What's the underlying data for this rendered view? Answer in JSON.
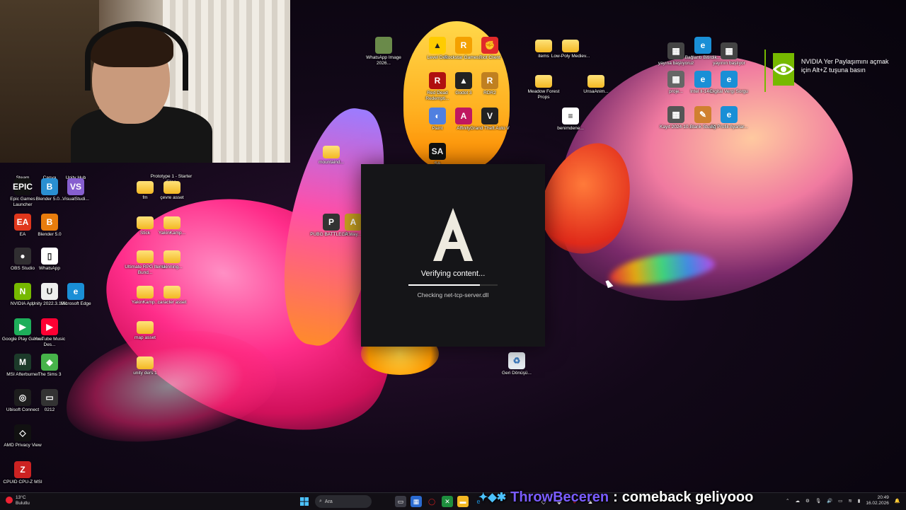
{
  "webcam": {
    "label": "webcam-feed"
  },
  "left_icons": [
    {
      "label": "Steam",
      "color": "#1b2838"
    },
    {
      "label": "Canva",
      "color": "#00c4cc"
    },
    {
      "label": "Unity Hub",
      "color": "#222"
    },
    {
      "label": "Epic Games Launcher",
      "color": "#111",
      "glyph": "EPIC"
    },
    {
      "label": "Blender 5.0...",
      "color": "#2a8fd1",
      "glyph": "B"
    },
    {
      "label": "VisualStudi...",
      "color": "#865fcf",
      "glyph": "VS"
    },
    {
      "label": "EA",
      "color": "#e0371c",
      "glyph": "EA"
    },
    {
      "label": "Blender 5.0",
      "color": "#e87d0d",
      "glyph": "B"
    },
    {
      "label": "OBS Studio",
      "color": "#302e31",
      "glyph": "●"
    },
    {
      "label": "WhatsApp",
      "color": "#fff",
      "glyph": "▯"
    },
    {
      "label": "NVIDIA App",
      "color": "#76b900",
      "glyph": "N"
    },
    {
      "label": "Unity 2022.3.19f1",
      "color": "#eee",
      "glyph": "U"
    },
    {
      "label": "Microsoft Edge",
      "color": "#1a8fd6",
      "glyph": "e"
    },
    {
      "label": "Google Play Games",
      "color": "#1eae5a",
      "glyph": "▶"
    },
    {
      "label": "YouTube Music Des...",
      "color": "#ff0033",
      "glyph": "▶"
    },
    {
      "label": "MSI Afterburner",
      "color": "#1c3a2a",
      "glyph": "M"
    },
    {
      "label": "The Sims 3",
      "color": "#47b34a",
      "glyph": "◆"
    },
    {
      "label": "Ubisoft Connect",
      "color": "#1d1d1d",
      "glyph": "◎"
    },
    {
      "label": "0212",
      "color": "#333",
      "glyph": "▭"
    },
    {
      "label": "AMD Privacy View",
      "color": "#111",
      "glyph": "◇"
    },
    {
      "label": "CPUID CPU-Z MSI",
      "color": "#c22",
      "glyph": "Z"
    }
  ],
  "mid_icons": [
    {
      "label": "Prototype 1 - Starter Files"
    },
    {
      "label": "fm"
    },
    {
      "label": "çevre asset"
    },
    {
      "label": "Stick"
    },
    {
      "label": "YakinKamp..."
    },
    {
      "label": "Ultimate RPG Items Bund..."
    },
    {
      "label": "skinning..."
    },
    {
      "label": "YakinKamp..."
    },
    {
      "label": "caracter asset"
    },
    {
      "label": "map asset"
    },
    {
      "label": "unity ders 1"
    }
  ],
  "top_icons": [
    {
      "label": "WhatsApp Image 2026...",
      "color": "#6a8a4a",
      "glyph": ""
    },
    {
      "label": "Level Dev",
      "color": "#ffcc00",
      "glyph": "▲"
    },
    {
      "label": "Rockstar Games...",
      "color": "#f4a100",
      "glyph": "R"
    },
    {
      "label": "Riot Client",
      "color": "#e02a2a",
      "glyph": "✊"
    },
    {
      "label": "items",
      "folder": true
    },
    {
      "label": "Low-Poly Mediev...",
      "folder": true
    },
    {
      "label": "Red Dead Redempti...",
      "color": "#b01010",
      "glyph": "R"
    },
    {
      "label": "Godot 3",
      "color": "#222",
      "glyph": "▲"
    },
    {
      "label": "RDR2",
      "color": "#c08020",
      "glyph": "R"
    },
    {
      "label": "Meadow Forest Props",
      "folder": true
    },
    {
      "label": "UnsaAnim...",
      "folder": true
    },
    {
      "label": "Paint",
      "color": "#5080e0",
      "glyph": "◐"
    },
    {
      "label": "Affinity",
      "color": "#c01860",
      "glyph": "A"
    },
    {
      "label": "Grand Theft Auto V",
      "color": "#222",
      "glyph": "V"
    },
    {
      "label": "benimdene...",
      "color": "#fff",
      "glyph": "≡"
    },
    {
      "label": "SA",
      "color": "#111",
      "glyph": "SA"
    },
    {
      "label": "mountaind...",
      "folder": true
    },
    {
      "label": "PUBG BATTLEGR...",
      "color": "#333",
      "glyph": "P"
    },
    {
      "label": "A Way...",
      "color": "#c8a020",
      "glyph": "A"
    }
  ],
  "right_icons": [
    {
      "label": "yayına başlıyoruz",
      "color": "#444",
      "glyph": "▦"
    },
    {
      "label": "Bağlantı Bitirdik...",
      "color": "#1a8fd6",
      "glyph": "e"
    },
    {
      "label": "yayının başlıyor",
      "color": "#444",
      "glyph": "▦"
    },
    {
      "label": "proje...",
      "color": "#666",
      "glyph": "▦"
    },
    {
      "label": "Intel Il-140...",
      "color": "#1a8fd6",
      "glyph": "e"
    },
    {
      "label": "Digital Vergi Sorgu",
      "color": "#1a8fd6",
      "glyph": "e"
    },
    {
      "label": "Kayıt 2024-10...",
      "color": "#555",
      "glyph": "▦"
    },
    {
      "label": "Blank Studio",
      "color": "#d08030",
      "glyph": "✎"
    },
    {
      "label": "Ağ Profili Ayarlar...",
      "color": "#1a8fd6",
      "glyph": "e"
    }
  ],
  "recycle": {
    "label": "Geri Dönüşü..."
  },
  "launcher": {
    "status": "Verifying content...",
    "detail": "Checking net-tcp-server.dll",
    "progress": 0.8
  },
  "nvidia": {
    "message": "NVIDIA Yer Paylaşımını açmak için Alt+Z tuşuna basın"
  },
  "taskbar": {
    "weather_temp": "13°C",
    "weather_desc": "Bulutlu",
    "search_placeholder": "Ara",
    "time": "20:49",
    "date": "16.02.2026"
  },
  "chat": {
    "user": "ThrowBeceren",
    "separator": ":",
    "message": "comeback geliyooo"
  }
}
